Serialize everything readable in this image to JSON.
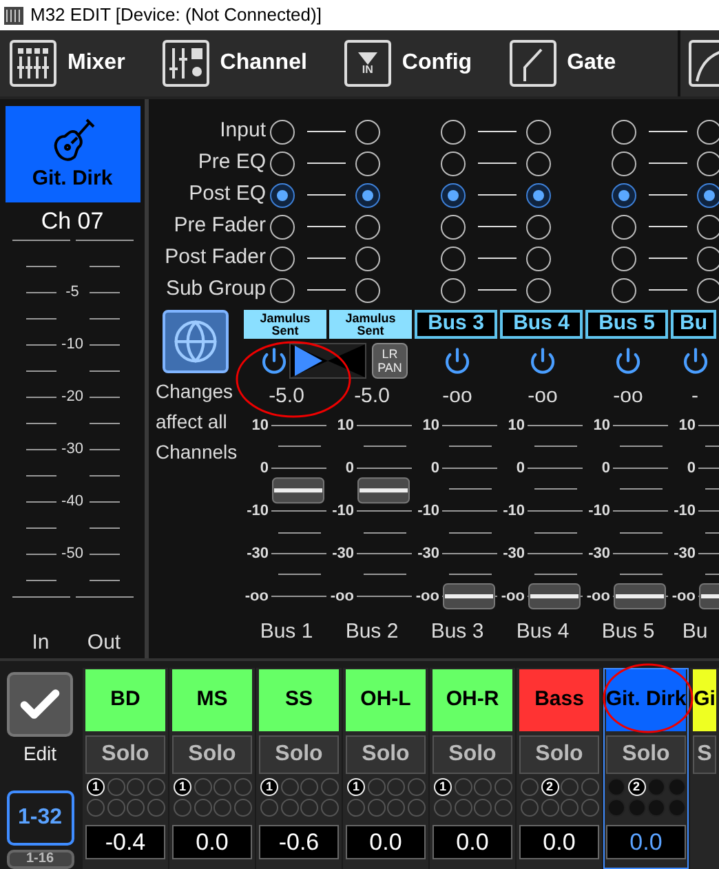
{
  "window": {
    "title": "M32 EDIT [Device: (Not Connected)]"
  },
  "tabs": [
    {
      "label": "Mixer",
      "kind": "mixer",
      "selected": false
    },
    {
      "label": "Channel",
      "kind": "channel",
      "selected": false
    },
    {
      "label": "Config",
      "kind": "config",
      "icon_text": "IN",
      "selected": false
    },
    {
      "label": "Gate",
      "kind": "gate",
      "selected": false
    },
    {
      "kind": "eq",
      "selected": false
    }
  ],
  "channel": {
    "name": "Git. Dirk",
    "color": "#0a64ff",
    "number": "Ch 07",
    "meter_labels": [
      "-5",
      "-10",
      "-20",
      "-30",
      "-40",
      "-50"
    ],
    "meter_columns": [
      "In",
      "Out"
    ]
  },
  "tap_rows": [
    {
      "label": "Input",
      "cells": [
        {
          "selected": false
        },
        {
          "selected": false
        },
        {
          "selected": false
        },
        {
          "selected": false
        },
        {
          "selected": false
        },
        {
          "selected": false
        }
      ]
    },
    {
      "label": "Pre EQ",
      "cells": [
        {
          "selected": false
        },
        {
          "selected": false
        },
        {
          "selected": false
        },
        {
          "selected": false
        },
        {
          "selected": false
        },
        {
          "selected": false
        }
      ]
    },
    {
      "label": "Post EQ",
      "cells": [
        {
          "selected": true
        },
        {
          "selected": true
        },
        {
          "selected": true
        },
        {
          "selected": true
        },
        {
          "selected": true
        },
        {
          "selected": true
        }
      ]
    },
    {
      "label": "Pre Fader",
      "cells": [
        {
          "selected": false
        },
        {
          "selected": false
        },
        {
          "selected": false
        },
        {
          "selected": false
        },
        {
          "selected": false
        },
        {
          "selected": false
        }
      ]
    },
    {
      "label": "Post Fader",
      "cells": [
        {
          "selected": false
        },
        {
          "selected": false
        },
        {
          "selected": false
        },
        {
          "selected": false
        },
        {
          "selected": false
        },
        {
          "selected": false
        }
      ]
    },
    {
      "label": "Sub Group",
      "cells": [
        {
          "selected": false
        },
        {
          "selected": false
        },
        {
          "selected": false
        },
        {
          "selected": false
        },
        {
          "selected": false
        },
        {
          "selected": false
        }
      ]
    }
  ],
  "globe_note": "Changes affect all Channels",
  "pan": {
    "level": 0.1,
    "button": "LR PAN"
  },
  "buses": [
    {
      "header": "Jamulus Sent",
      "kind": "named",
      "power": true,
      "value": "-5.0",
      "scale": [
        "10",
        "0",
        "-10",
        "-30",
        "-oo"
      ],
      "level": 0.62,
      "label": "Bus 1"
    },
    {
      "header": "Jamulus Sent",
      "kind": "named",
      "value": "-5.0",
      "scale": [
        "10",
        "0",
        "-10",
        "-30",
        "-oo"
      ],
      "level": 0.62,
      "label": "Bus 2"
    },
    {
      "header": "Bus 3",
      "kind": "bus",
      "power": true,
      "value": "-oo",
      "scale": [
        "10",
        "0",
        "-10",
        "-30",
        "-oo"
      ],
      "level": 0,
      "label": "Bus 3"
    },
    {
      "header": "Bus 4",
      "kind": "bus",
      "power": true,
      "value": "-oo",
      "scale": [
        "10",
        "0",
        "-10",
        "-30",
        "-oo"
      ],
      "level": 0,
      "label": "Bus 4"
    },
    {
      "header": "Bus 5",
      "kind": "bus",
      "power": true,
      "value": "-oo",
      "scale": [
        "10",
        "0",
        "-10",
        "-30",
        "-oo"
      ],
      "level": 0,
      "label": "Bus 5"
    },
    {
      "header": "Bu",
      "kind": "bus",
      "power": true,
      "value": "-",
      "scale": [
        "10",
        "0",
        "-10",
        "-30",
        "-oo"
      ],
      "level": 0,
      "label": "Bu"
    }
  ],
  "edit": {
    "label": "Edit",
    "checked": true
  },
  "banks": [
    {
      "label": "1-32",
      "selected": true
    },
    {
      "label": "1-16",
      "selected": false
    }
  ],
  "strips": [
    {
      "name": "BD",
      "color": "#66ff66",
      "selected": false,
      "solo": "Solo",
      "dots": [
        {
          "on": true,
          "label": "1"
        },
        {
          "on": false
        },
        {
          "on": false
        },
        {
          "on": false
        },
        {
          "on": false
        },
        {
          "on": false
        },
        {
          "on": false
        },
        {
          "on": false
        }
      ],
      "value": "-0.4"
    },
    {
      "name": "MS",
      "color": "#66ff66",
      "selected": false,
      "solo": "Solo",
      "dots": [
        {
          "on": true,
          "label": "1"
        },
        {
          "on": false
        },
        {
          "on": false
        },
        {
          "on": false
        },
        {
          "on": false
        },
        {
          "on": false
        },
        {
          "on": false
        },
        {
          "on": false
        }
      ],
      "value": "0.0"
    },
    {
      "name": "SS",
      "color": "#66ff66",
      "selected": false,
      "solo": "Solo",
      "dots": [
        {
          "on": true,
          "label": "1"
        },
        {
          "on": false
        },
        {
          "on": false
        },
        {
          "on": false
        },
        {
          "on": false
        },
        {
          "on": false
        },
        {
          "on": false
        },
        {
          "on": false
        }
      ],
      "value": "-0.6"
    },
    {
      "name": "OH-L",
      "color": "#66ff66",
      "selected": false,
      "solo": "Solo",
      "dots": [
        {
          "on": true,
          "label": "1"
        },
        {
          "on": false
        },
        {
          "on": false
        },
        {
          "on": false
        },
        {
          "on": false
        },
        {
          "on": false
        },
        {
          "on": false
        },
        {
          "on": false
        }
      ],
      "value": "0.0"
    },
    {
      "name": "OH-R",
      "color": "#66ff66",
      "selected": false,
      "solo": "Solo",
      "dots": [
        {
          "on": true,
          "label": "1"
        },
        {
          "on": false
        },
        {
          "on": false
        },
        {
          "on": false
        },
        {
          "on": false
        },
        {
          "on": false
        },
        {
          "on": false
        },
        {
          "on": false
        }
      ],
      "value": "0.0"
    },
    {
      "name": "Bass",
      "color": "#ff3333",
      "selected": false,
      "solo": "Solo",
      "dots": [
        {
          "on": false
        },
        {
          "on": true,
          "label": "2"
        },
        {
          "on": false
        },
        {
          "on": false
        },
        {
          "on": false
        },
        {
          "on": false
        },
        {
          "on": false
        },
        {
          "on": false
        }
      ],
      "value": "0.0"
    },
    {
      "name": "Git. Dirk",
      "color": "#0a64ff",
      "selected": true,
      "solo": "Solo",
      "dots": [
        {
          "on": false
        },
        {
          "on": true,
          "label": "2"
        },
        {
          "on": false
        },
        {
          "on": false
        },
        {
          "on": false
        },
        {
          "on": false
        },
        {
          "on": false
        },
        {
          "on": false
        }
      ],
      "value": "0.0"
    },
    {
      "name": "Gi",
      "color": "#eeff22",
      "selected": false,
      "solo": "S"
    }
  ]
}
